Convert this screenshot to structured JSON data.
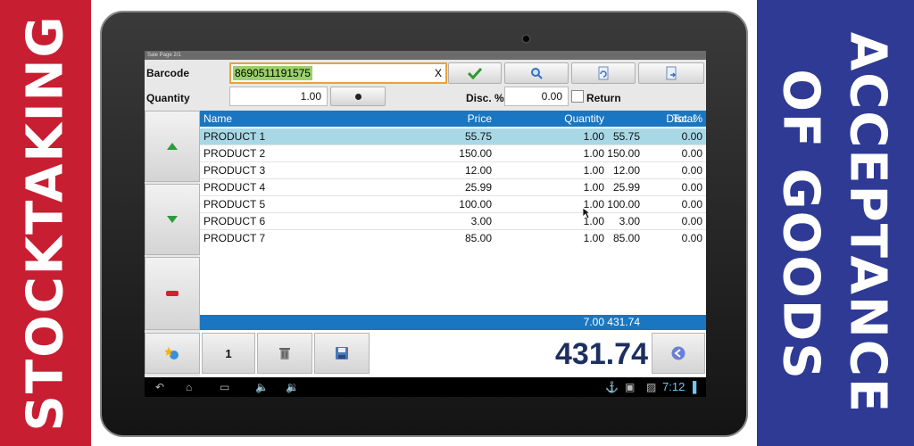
{
  "banners": {
    "left_text": "STOCKTAKING",
    "right_line1": "ACCEPTANCE",
    "right_line2": "OF GOODS",
    "left_color": "#c81e32",
    "right_color": "#2e3a94"
  },
  "window": {
    "title": "Sale Page 2/1"
  },
  "form": {
    "barcode_label": "Barcode",
    "barcode_value": "8690511191575",
    "clear_label": "X",
    "quantity_label": "Quantity",
    "quantity_value": "1.00",
    "disc_label": "Disc. %",
    "disc_value": "0.00",
    "return_label": "Return"
  },
  "table": {
    "columns": [
      "Name",
      "Price",
      "Quantity",
      "Total",
      "Disc. %"
    ],
    "rows": [
      {
        "name": "PRODUCT 1",
        "price": "55.75",
        "qty": "1.00",
        "total": "55.75",
        "disc": "0.00"
      },
      {
        "name": "PRODUCT 2",
        "price": "150.00",
        "qty": "1.00",
        "total": "150.00",
        "disc": "0.00"
      },
      {
        "name": "PRODUCT 3",
        "price": "12.00",
        "qty": "1.00",
        "total": "12.00",
        "disc": "0.00"
      },
      {
        "name": "PRODUCT 4",
        "price": "25.99",
        "qty": "1.00",
        "total": "25.99",
        "disc": "0.00"
      },
      {
        "name": "PRODUCT 5",
        "price": "100.00",
        "qty": "1.00",
        "total": "100.00",
        "disc": "0.00"
      },
      {
        "name": "PRODUCT 6",
        "price": "3.00",
        "qty": "1.00",
        "total": "3.00",
        "disc": "0.00"
      },
      {
        "name": "PRODUCT 7",
        "price": "85.00",
        "qty": "1.00",
        "total": "85.00",
        "disc": "0.00"
      }
    ],
    "footer_qty": "7.00",
    "footer_total": "431.74"
  },
  "bottom": {
    "page_label": "1",
    "grand_total": "431.74"
  },
  "statusbar": {
    "time": "7:12"
  },
  "colors": {
    "accent": "#1a76c0",
    "selected_row": "#a8d8e6",
    "barcode_highlight": "#9ad06b"
  }
}
